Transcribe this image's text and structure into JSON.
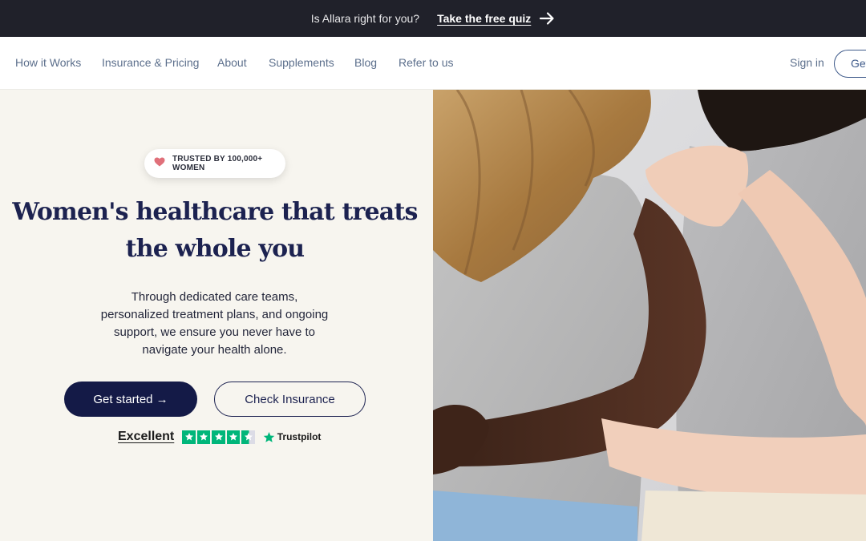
{
  "announcement": {
    "text": "Is Allara right for you?",
    "cta": "Take the free quiz",
    "arrow_icon": "arrow-right-icon"
  },
  "nav": {
    "links": [
      "How it Works",
      "Insurance & Pricing",
      "About",
      "Supplements",
      "Blog",
      "Refer to us"
    ],
    "signin": "Sign in",
    "get_started": "Get started"
  },
  "hero": {
    "badge": "TRUSTED BY 100,000+ WOMEN",
    "badge_icon": "heart-icon",
    "headline": "Women's healthcare that treats the whole you",
    "description": "Through dedicated care teams, personalized treatment plans, and ongoing support, we ensure you never have to navigate your health alone.",
    "primary_cta": "Get started →",
    "secondary_cta": "Check Insurance",
    "rating_label": "Excellent",
    "rating_stars": 4.5,
    "rating_brand": "Trustpilot"
  },
  "colors": {
    "navy": "#141a47",
    "trustpilot_green": "#00b67a",
    "heart": "#e0707a"
  }
}
